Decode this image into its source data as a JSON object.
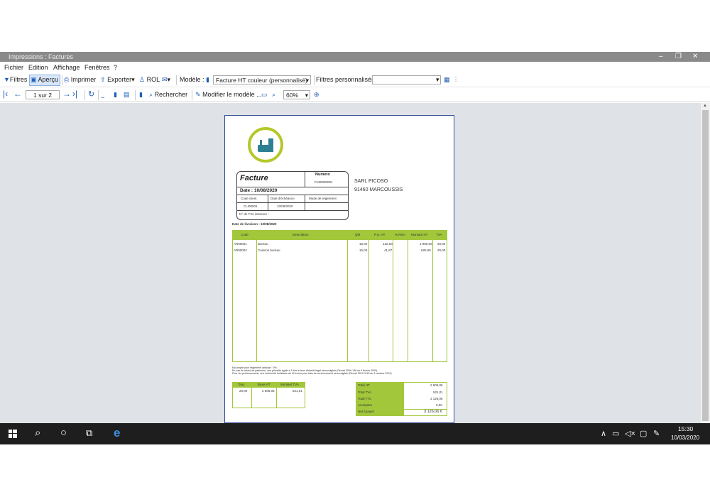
{
  "window": {
    "title": "Impressions : Factures",
    "min": "–",
    "max": "❐",
    "close": "✕"
  },
  "menu": [
    "Fichier",
    "Edition",
    "Affichage",
    "Fenêtres",
    "?"
  ],
  "toolbar1": {
    "filtres": "Filtres",
    "apercu": "Aperçu",
    "imprimer": "Imprimer",
    "exporter": "Exporter",
    "rol": "ROL",
    "modele_label": "Modèle :",
    "modele_value": "Facture HT couleur (personnalisé)",
    "filtres_perso_label": "Filtres personnalisés :",
    "filtres_perso_value": ""
  },
  "toolbar2": {
    "page": "1 sur 2",
    "rechercher": "Rechercher",
    "modifier": "Modifier le modèle ...",
    "zoom": "60%"
  },
  "invoice": {
    "title": "Facture",
    "numero_label": "Numéro",
    "numero": "FA00000001",
    "date": "Date : 10/08/2020",
    "h_code_client": "Code client",
    "h_echeance": "Date d'échéance",
    "h_reglement": "Mode de règlement",
    "code_client": "CLI00001",
    "echeance": "10/08/2020",
    "tva_intra": "N° de TVA intracom :",
    "client_name": "SARL PICOSO",
    "client_city": "91460 MARCOUSSIS",
    "livraison": "Date de livraison : 10/08/2020",
    "cols": {
      "code": "Code",
      "desc": "Description",
      "qte": "Qté",
      "pu": "P.U. HT",
      "rem": "% Rem",
      "montant": "Montant HT",
      "tva": "TVA"
    },
    "lines": [
      {
        "code": "AR00001",
        "desc": "Bureau",
        "qte": "15,00",
        "pu": "132,00",
        "montant": "1 980,00",
        "tva": "20,00"
      },
      {
        "code": "AR00002",
        "desc": "Caisson bureau",
        "qte": "15,00",
        "pu": "41,67",
        "montant": "625,05",
        "tva": "20,00"
      }
    ],
    "notes": [
      "Escompte pour règlement anticipé : 0%",
      "En cas de retard de paiement, une pénalité égale à 3 fois le taux d'intérêt légal sera exigible (Décret 2009-138 du 9 février 2009).",
      "Pour les professionnels, une indemnité forfaitaire de 40 euros pour frais de recouvrement sera exigible (Décret 2012-1115 du 9 octobre 2012)."
    ],
    "tva_table": {
      "h_taux": "Taux",
      "h_base": "Base HT",
      "h_montant": "Montant TVA",
      "taux": "20,00",
      "base": "2 605,05",
      "montant": "521,01"
    },
    "totals": [
      {
        "label": "Total HT",
        "value": "2 605,05"
      },
      {
        "label": "Total TVA",
        "value": "521,01"
      },
      {
        "label": "Total TTC",
        "value": "3 126,06"
      },
      {
        "label": "Acomptes",
        "value": "0,00"
      },
      {
        "label": "Net à payer",
        "value": "3 126,06 €"
      }
    ]
  },
  "taskbar": {
    "time": "15:30",
    "date": "10/03/2020"
  }
}
